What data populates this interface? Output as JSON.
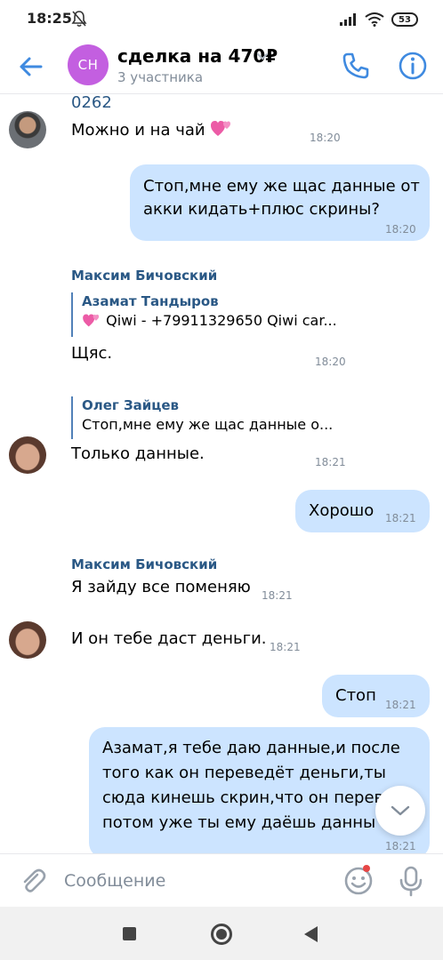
{
  "status_bar": {
    "time": "18:25",
    "battery": "53",
    "icons": [
      "bell-off-icon",
      "signal-icon",
      "wifi-icon",
      "battery-icon"
    ]
  },
  "header": {
    "avatar_initials": "СН",
    "title": "сделка на 470₽",
    "subtitle": "3 участника",
    "avatar_color": "#c35fe0"
  },
  "messages": {
    "m0": {
      "cut_text": "0262",
      "text": "Можно и на чай",
      "time": "18:20"
    },
    "m1": {
      "lines": [
        "Стоп,мне ему же щас данные от",
        "акки кидать+плюс скрины?"
      ],
      "time": "18:20"
    },
    "m2": {
      "sender": "Максим Бичовский",
      "reply_name": "Азамат Тандыров",
      "reply_text": "Qiwi - +79911329650 Qiwi car...",
      "text": "Щяс.",
      "time": "18:20"
    },
    "m3": {
      "reply_name": "Олег Зайцев",
      "reply_text": "Стоп,мне ему же щас данные о...",
      "text": "Только данные.",
      "time": "18:21"
    },
    "m4": {
      "text": "Хорошо",
      "time": "18:21"
    },
    "m5": {
      "sender": "Максим Бичовский",
      "text": "Я зайду все поменяю",
      "time": "18:21"
    },
    "m6": {
      "text": "И он тебе даст деньги.",
      "time": "18:21"
    },
    "m7": {
      "text": "Стоп",
      "time": "18:21"
    },
    "m8": {
      "lines": [
        "Азамат,я тебе даю данные,и после",
        "того как он переведёт деньги,ты",
        "сюда кинешь скрин,что он перев",
        "потом уже ты ему даёшь данны"
      ],
      "time": "18:21"
    }
  },
  "composer": {
    "placeholder": "Сообщение",
    "icons": [
      "paperclip-icon",
      "sticker-icon",
      "microphone-icon"
    ]
  },
  "colors": {
    "accent": "#3f8ae0",
    "outgoing_bubble": "#cce4ff",
    "sender_name": "#2a5885",
    "secondary_text": "#818c99"
  }
}
